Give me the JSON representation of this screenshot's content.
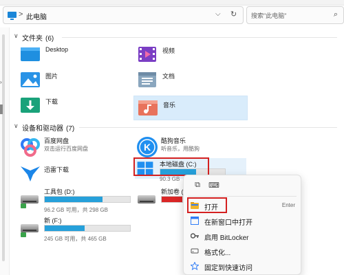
{
  "address_bar": {
    "separator": ">",
    "location": "此电脑",
    "dropdown_icon": "chevron-down",
    "refresh_icon": "refresh"
  },
  "search": {
    "placeholder": "搜索\"此电脑\"",
    "icon": "search"
  },
  "sections": {
    "folders": {
      "title": "文件夹",
      "count": "(6)"
    },
    "devices": {
      "title": "设备和驱动器",
      "count": "(7)"
    }
  },
  "folders": [
    {
      "label": "Desktop",
      "icon": "desktop-folder",
      "selected": false
    },
    {
      "label": "视频",
      "icon": "videos-folder",
      "selected": false
    },
    {
      "label": "图片",
      "icon": "pictures-folder",
      "selected": false
    },
    {
      "label": "文档",
      "icon": "documents-folder",
      "selected": false
    },
    {
      "label": "下载",
      "icon": "downloads-folder",
      "selected": false
    },
    {
      "label": "音乐",
      "icon": "music-folder",
      "selected": true
    }
  ],
  "apps": [
    {
      "name": "百度网盘",
      "subtitle": "双击运行百度网盘",
      "icon": "baidu-netdisk"
    },
    {
      "name": "酷狗音乐",
      "subtitle": "听音乐，用酷狗",
      "icon": "kugou-music"
    },
    {
      "name": "迅雷下载",
      "subtitle": "",
      "icon": "xunlei"
    }
  ],
  "drives": [
    {
      "name": "本地磁盘 (C:)",
      "stats": "90.3 GB",
      "used_fraction": 0.55,
      "bar_color": "#26a0da",
      "highlighted": true
    },
    {
      "name": "工具包 (D:)",
      "stats": "96.2 GB 可用，共 298 GB",
      "used_fraction": 0.68,
      "bar_color": "#26a0da",
      "highlighted": false
    },
    {
      "name": "新加卷 (E:)",
      "stats": "",
      "used_fraction": 0.93,
      "bar_color": "#da2626",
      "highlighted": false
    },
    {
      "name": "新 (F:)",
      "stats": "245 GB 可用，共 465 GB",
      "used_fraction": 0.47,
      "bar_color": "#26a0da",
      "highlighted": false
    }
  ],
  "context_menu": {
    "quick_actions": [
      "copy-icon",
      "rename-icon"
    ],
    "items": [
      {
        "label": "打开",
        "shortcut": "Enter",
        "icon": "open-folder-icon",
        "highlighted": true
      },
      {
        "label": "在新窗口中打开",
        "shortcut": "",
        "icon": "new-window-icon",
        "highlighted": false
      },
      {
        "label": "启用 BitLocker",
        "shortcut": "",
        "icon": "bitlocker-key-icon",
        "highlighted": false
      },
      {
        "label": "格式化...",
        "shortcut": "",
        "icon": "format-icon",
        "highlighted": false
      },
      {
        "label": "固定到快速访问",
        "shortcut": "",
        "icon": "pin-icon",
        "highlighted": false
      }
    ]
  },
  "colors": {
    "accent": "#26a0da",
    "warning_bar": "#da2626",
    "selection": "#d9ecfb",
    "annotation_red": "#d42020"
  }
}
